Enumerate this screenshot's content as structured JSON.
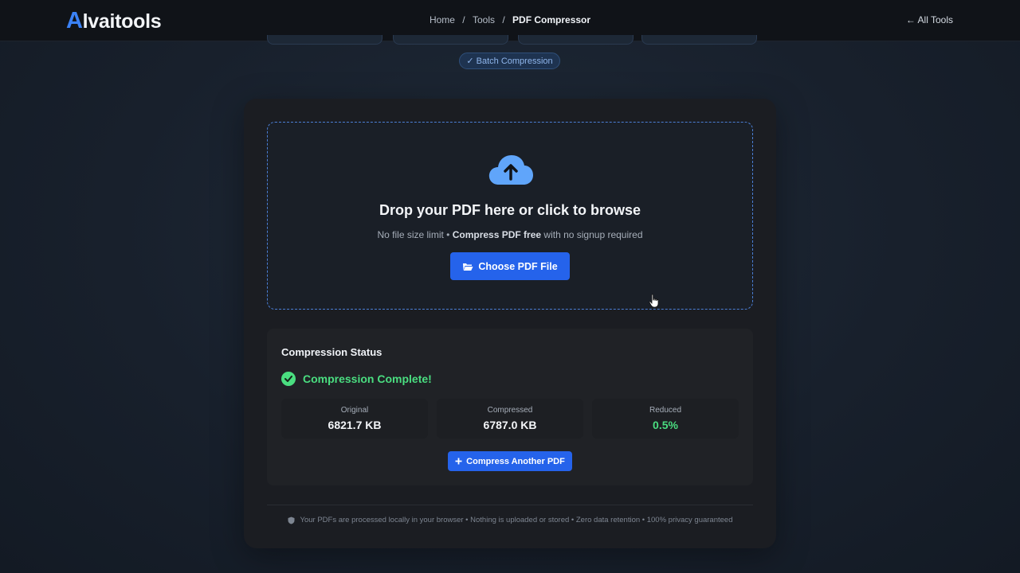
{
  "header": {
    "logo_letter": "A",
    "logo_rest": "lvaitools",
    "breadcrumb": [
      {
        "label": "Home"
      },
      {
        "label": "Tools"
      },
      {
        "label": "PDF Compressor"
      }
    ],
    "separator": "/",
    "all_tools_label": "← All Tools"
  },
  "feature_pill": "✓ Batch Compression",
  "dropzone": {
    "icon": "cloud-upload-icon",
    "title": "Drop your PDF here or click to browse",
    "subtitle_pre": "No file size limit • ",
    "subtitle_bold": "Compress PDF free",
    "subtitle_post": " with no signup required",
    "button_label": "Choose PDF File",
    "button_icon": "folder-open-icon"
  },
  "status": {
    "title": "Compression Status",
    "result_text": "Compression Complete!",
    "stats": [
      {
        "label": "Original",
        "value": "6821.7 KB"
      },
      {
        "label": "Compressed",
        "value": "6787.0 KB"
      },
      {
        "label": "Reduced",
        "value": "0.5%"
      }
    ],
    "again_label": "Compress Another PDF"
  },
  "privacy_note": "Your PDFs are processed locally in your browser • Nothing is uploaded or stored • Zero data retention • 100% privacy guaranteed",
  "colors": {
    "accent": "#2563eb",
    "success": "#4ade80",
    "dropzone_border": "#4b7fd6",
    "card_bg": "#1b1d22"
  }
}
